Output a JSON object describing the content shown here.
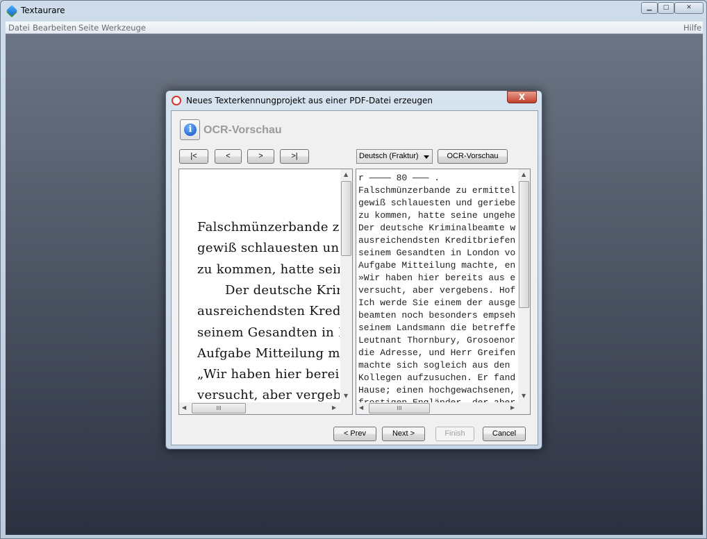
{
  "app": {
    "title": "Textaurare",
    "window_controls": [
      "minimize",
      "maximize",
      "close"
    ]
  },
  "menu": {
    "items": [
      "Datei",
      "Bearbeiten",
      "Seite",
      "Werkzeuge"
    ],
    "help": "Hilfe"
  },
  "dialog": {
    "title": "Neues Texterkennungprojekt aus einer PDF-Datei erzeugen",
    "close_label": "X",
    "heading": "OCR-Vorschau",
    "nav": {
      "first": "|<",
      "prev": "<",
      "next": ">",
      "last": ">|"
    },
    "language": "Deutsch (Fraktur)",
    "ocr_button": "OCR-Vorschau",
    "page_lines": [
      "Falschmünzerbande zu er",
      "gewiß schlauesten und ge",
      "zu kommen, hatte seine",
      "Der deutsche Krim",
      "ausreichendsten Kreditbri",
      "seinem Gesandten in Lo",
      "Aufgabe Mitteilung ma",
      "„Wir haben hier berei",
      "versucht, aber vergebens"
    ],
    "ocr_lines": [
      "r ———— 80 ——— .",
      "Falschmünzerbande zu ermittel",
      "gewiß schlauesten und geriebe",
      "zu kommen, hatte seine ungehe",
      "Der deutsche Kriminalbeamte w",
      "ausreichendsten Kreditbriefen",
      "seinem Gesandten in London vo",
      "Aufgabe Mitteilung machte, en",
      "»Wir haben hier bereits aus e",
      "versucht, aber vergebens. Hof",
      "Ich werde Sie einem der ausge",
      "beamten noch besonders empseh",
      "seinem Landsmann die betreffe",
      "Leutnant Thornbury, Grosoenor",
      "die Adresse, und Herr Greifen",
      "machte sich sogleich aus den ",
      "Kollegen aufzusuchen. Er fand",
      "Hause; einen hochgewachsenen,",
      "frostigen Engländer, der aber"
    ],
    "footer": {
      "prev": "< Prev",
      "next": "Next >",
      "finish": "Finish",
      "cancel": "Cancel"
    }
  }
}
